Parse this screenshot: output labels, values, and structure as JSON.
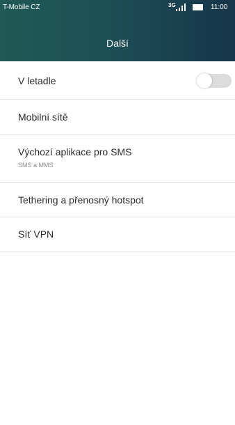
{
  "status_bar": {
    "carrier": "T-Mobile CZ",
    "network": "3G",
    "time": "11:00",
    "signal_icon": "signal-bars-icon",
    "battery_icon": "battery-icon"
  },
  "header": {
    "title": "Další",
    "colors": {
      "start": "#1f5a55",
      "end": "#17354a"
    }
  },
  "list": {
    "items": [
      {
        "label": "V letadle",
        "toggle_on": false
      },
      {
        "label": "Mobilní sítě"
      },
      {
        "label": "Výchozí aplikace pro SMS",
        "sublabel": "SMS a MMS"
      },
      {
        "label": "Tethering a přenosný hotspot"
      },
      {
        "label": "Síť VPN"
      }
    ]
  }
}
